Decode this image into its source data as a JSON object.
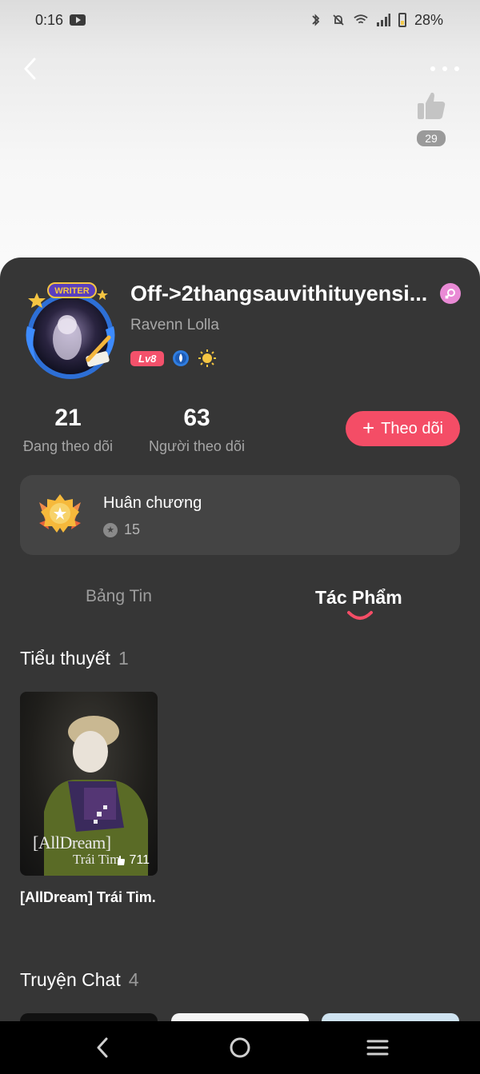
{
  "status_bar": {
    "time": "0:16",
    "battery": "28%",
    "icons": [
      "youtube-icon",
      "bluetooth-icon",
      "mute-icon",
      "wifi-icon",
      "signal-icon",
      "battery-icon"
    ]
  },
  "header": {
    "back_icon": "chevron-left-icon",
    "more_icon": "more-dots-icon",
    "like_icon": "thumbs-up-icon",
    "like_count": "29"
  },
  "profile": {
    "avatar_badge": "WRITER",
    "username": "Off->2thangsauvithituyensi...",
    "subname": "Ravenn Lolla",
    "level": "Lv8",
    "gender_icon": "female-icon",
    "following_count": "21",
    "following_label": "Đang theo dõi",
    "followers_count": "63",
    "followers_label": "Người theo dõi",
    "follow_button": "Theo dõi"
  },
  "medal": {
    "title": "Huân chương",
    "count": "15"
  },
  "tabs": [
    {
      "label": "Bảng Tin",
      "active": false
    },
    {
      "label": "Tác Phẩm",
      "active": true
    }
  ],
  "novels": {
    "title": "Tiểu thuyết",
    "count": "1",
    "items": [
      {
        "cover_title": "[AllDream]",
        "cover_subtitle": "Trái Tim",
        "views": "711",
        "name": "[AllDream] Trái Tim."
      }
    ]
  },
  "chat_stories": {
    "title": "Truyện Chat",
    "count": "4"
  },
  "colors": {
    "accent": "#f44d66",
    "sheet_bg": "#363636",
    "card_bg": "#444444",
    "gender": "#e98ad5"
  },
  "nav": {
    "back_icon": "nav-back-icon",
    "home_icon": "nav-home-icon",
    "recents_icon": "nav-recents-icon"
  }
}
